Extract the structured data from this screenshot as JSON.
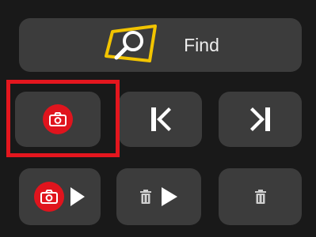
{
  "find": {
    "label": "Find",
    "icon": "find-icon"
  },
  "buttons": [
    {
      "name": "capture-button",
      "icon": "camera-icon"
    },
    {
      "name": "first-button",
      "icon": "skip-first-icon"
    },
    {
      "name": "last-button",
      "icon": "skip-last-icon"
    },
    {
      "name": "capture-play-button",
      "icon": "camera-play-icon"
    },
    {
      "name": "delete-play-button",
      "icon": "trash-play-icon"
    },
    {
      "name": "delete-button",
      "icon": "trash-icon"
    }
  ],
  "selected": "capture-button",
  "colors": {
    "background": "#191919",
    "button": "#3c3c3c",
    "accent_red": "#e0141d",
    "highlight": "#e4161e",
    "find_icon": "#f2c400",
    "foreground": "#ededed"
  }
}
